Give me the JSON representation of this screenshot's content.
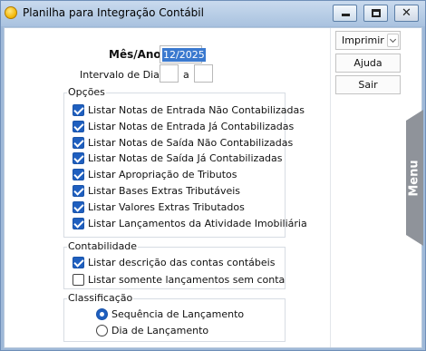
{
  "window": {
    "title": "Planilha para Integração Contábil",
    "close_glyph": "✕",
    "icons": {
      "app": "app-icon",
      "minimize": "minimize-icon",
      "maximize": "maximize-icon",
      "close": "close-icon"
    }
  },
  "form": {
    "mes_ano_label": "Mês/Ano",
    "mes_ano_value": "12/2025",
    "intervalo_label": "Intervalo de Dias",
    "intervalo_sep": "a",
    "intervalo_de": "",
    "intervalo_ate": ""
  },
  "opcoes": {
    "title": "Opções",
    "items": [
      {
        "label": "Listar Notas de Entrada Não Contabilizadas",
        "checked": true
      },
      {
        "label": "Listar Notas de Entrada Já Contabilizadas",
        "checked": true
      },
      {
        "label": "Listar Notas de Saída Não Contabilizadas",
        "checked": true
      },
      {
        "label": "Listar Notas de Saída Já Contabilizadas",
        "checked": true
      },
      {
        "label": "Listar Apropriação de Tributos",
        "checked": true
      },
      {
        "label": "Listar Bases Extras Tributáveis",
        "checked": true
      },
      {
        "label": "Listar Valores Extras Tributados",
        "checked": true
      },
      {
        "label": "Listar Lançamentos da Atividade Imobiliária",
        "checked": true
      }
    ]
  },
  "contabilidade": {
    "title": "Contabilidade",
    "items": [
      {
        "label": "Listar descrição das contas contábeis",
        "checked": true
      },
      {
        "label": "Listar somente lançamentos sem conta",
        "checked": false
      }
    ]
  },
  "classificacao": {
    "title": "Classificação",
    "options": [
      {
        "label": "Sequência de Lançamento",
        "selected": true
      },
      {
        "label": "Dia de Lançamento",
        "selected": false
      }
    ]
  },
  "actions": {
    "imprimir": "Imprimir",
    "ajuda": "Ajuda",
    "sair": "Sair"
  },
  "side_tab": {
    "label": "Menu"
  },
  "colors": {
    "accent": "#1f5fbf",
    "selection": "#3a79cf",
    "frame": "#9fb9d8",
    "menu_tab": "#8f939a"
  }
}
